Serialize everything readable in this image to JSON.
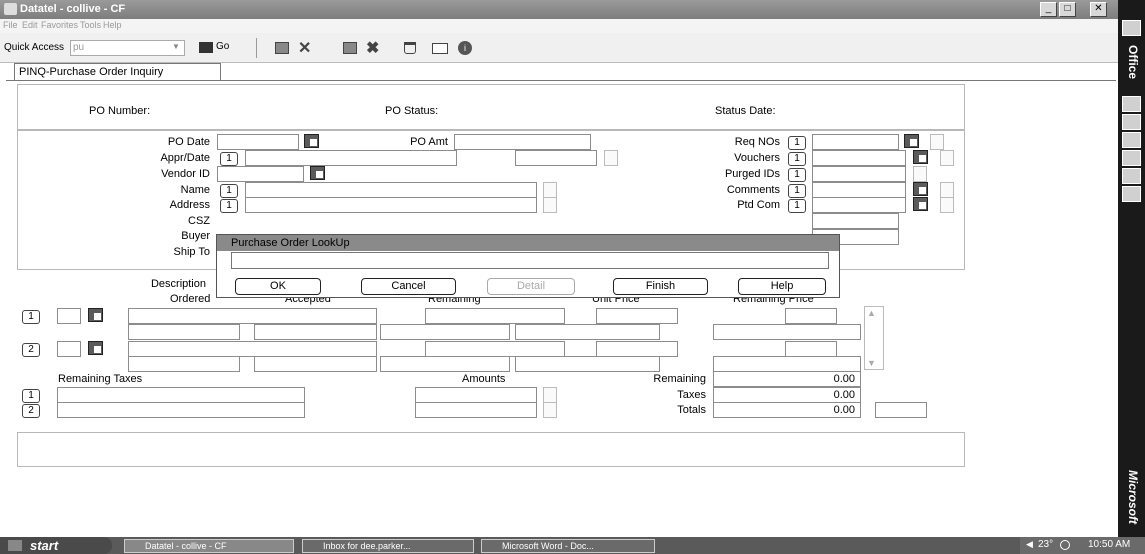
{
  "window": {
    "title": "Datatel - collive - CF",
    "buttons": [
      "_",
      "□",
      "✕"
    ]
  },
  "menu": [
    "File",
    "Edit",
    "Favorites",
    "Tools",
    "Help"
  ],
  "toolbar": {
    "quick_access_label": "Quick Access",
    "quick_access_value": "pu",
    "go_label": "Go"
  },
  "tab": {
    "label": "PINQ-Purchase Order Inquiry"
  },
  "header": {
    "po_number": "PO Number:",
    "po_status": "PO Status:",
    "status_date": "Status Date:"
  },
  "form": {
    "left_labels": [
      "PO Date",
      "Appr/Date",
      "Vendor ID",
      "Name",
      "Address",
      "CSZ",
      "Buyer",
      "Ship To"
    ],
    "po_amt": "PO Amt",
    "right_labels": [
      "Req NOs",
      "Vouchers",
      "Purged IDs",
      "Comments",
      "Ptd Com"
    ],
    "index_one": "1",
    "index_two": "2"
  },
  "lines": {
    "description": "Description",
    "ordered": "Ordered",
    "accepted": "Accepted",
    "remaining": "Remaining",
    "unit_price": "Unit Price",
    "remaining_price": "Remaining Price"
  },
  "taxes": {
    "remaining_taxes": "Remaining Taxes",
    "amounts": "Amounts",
    "remaining_label": "Remaining",
    "taxes_label": "Taxes",
    "totals_label": "Totals",
    "remaining_value": "0.00",
    "taxes_value": "0.00",
    "totals_value": "0.00"
  },
  "dialog": {
    "title": "Purchase Order LookUp",
    "input_value": "",
    "buttons": {
      "ok": "OK",
      "cancel": "Cancel",
      "detail": "Detail",
      "finish": "Finish",
      "help": "Help"
    }
  },
  "taskbar": {
    "start": "start",
    "items": [
      "Datatel - collive - CF",
      "Inbox for dee.parker...",
      "Microsoft Word - Doc..."
    ],
    "temperature": "23°",
    "time": "10:50 AM"
  },
  "officebar": {
    "top_label": "Office",
    "bottom_label": "Microsoft"
  }
}
